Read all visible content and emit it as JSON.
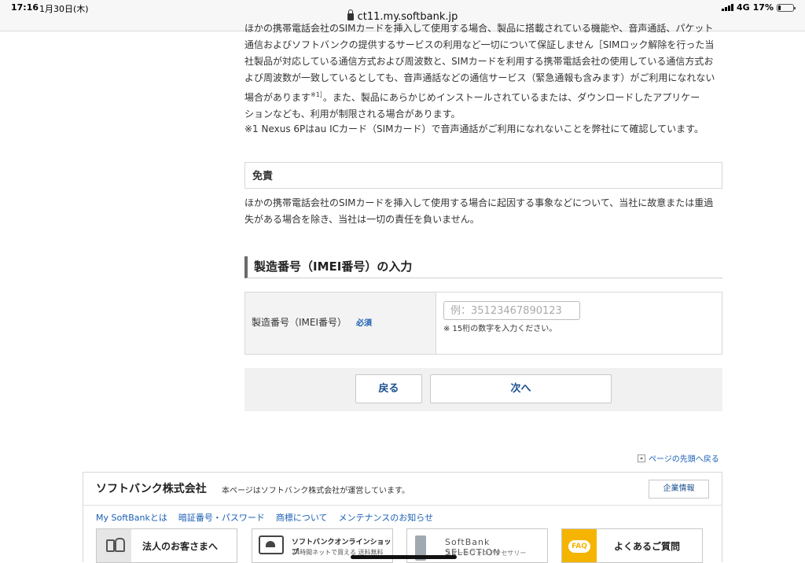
{
  "status_bar": {
    "time": "17:16",
    "date": "1月30日(木)",
    "network": "4G",
    "battery_percent": "17%",
    "battery_level": 0.17
  },
  "browser": {
    "url": "ct11.my.softbank.jp"
  },
  "content": {
    "paragraph1_lines": [
      "ほかの携帯電話会社のSIMカードを挿入して使用する場合、製品に搭載されている機能や、音声通話、パケット",
      "通信およびソフトバンクの提供するサービスの利用など一切について保証しません［SIMロック解除を行った当",
      "社製品が対応している通信方式および周波数と、SIMカードを利用する携帯電話会社の使用している通信方式お",
      "よび周波数が一致しているとしても、音声通話などの通信サービス（緊急通報も含みます）がご利用になれない",
      "場合があります",
      "。また、製品にあらかじめインストールされているまたは、ダウンロードしたアプリケー",
      "ションなども、利用が制限される場合があります。"
    ],
    "footnote_ref": "※1］",
    "note1": "※1 Nexus 6Pはau ICカード（SIMカード）で音声通話がご利用になれないことを弊社にて確認しています。",
    "disclaimer_heading": "免責",
    "disclaimer_lines": [
      "ほかの携帯電話会社のSIMカードを挿入して使用する場合に起因する事象などについて、当社に故意または重過",
      "失がある場合を除き、当社は一切の責任を負いません。"
    ],
    "section_title": "製造番号（IMEI番号）の入力",
    "form": {
      "label": "製造番号（IMEI番号）",
      "required": "必須",
      "placeholder": "例：35123467890123",
      "value": "",
      "note": "※ 15桁の数字を入力ください。"
    },
    "buttons": {
      "back": "戻る",
      "next": "次へ"
    },
    "page_top": "ページの先頭へ戻る"
  },
  "footer": {
    "company": "ソフトバンク株式会社",
    "description": "本ページはソフトバンク株式会社が運営しています。",
    "corp_info_button": "企業情報",
    "links": [
      "My SoftBankとは",
      "暗証番号・パスワード",
      "商標について",
      "メンテナンスのお知らせ"
    ],
    "banners": [
      {
        "text": "法人のお客さまへ",
        "icon": "business-people-icon"
      },
      {
        "text": "ソフトバンクオンラインショップ",
        "sub": "24時間ネットで買える 送料無料",
        "icon": "shop-cart-icon"
      },
      {
        "text": "SoftBank SELECTION",
        "sub": "スマートフォンアクセサリー",
        "icon": "accessory-icon"
      },
      {
        "text": "よくあるご質問",
        "icon_label": "FAQ",
        "icon": "faq-icon"
      }
    ]
  }
}
